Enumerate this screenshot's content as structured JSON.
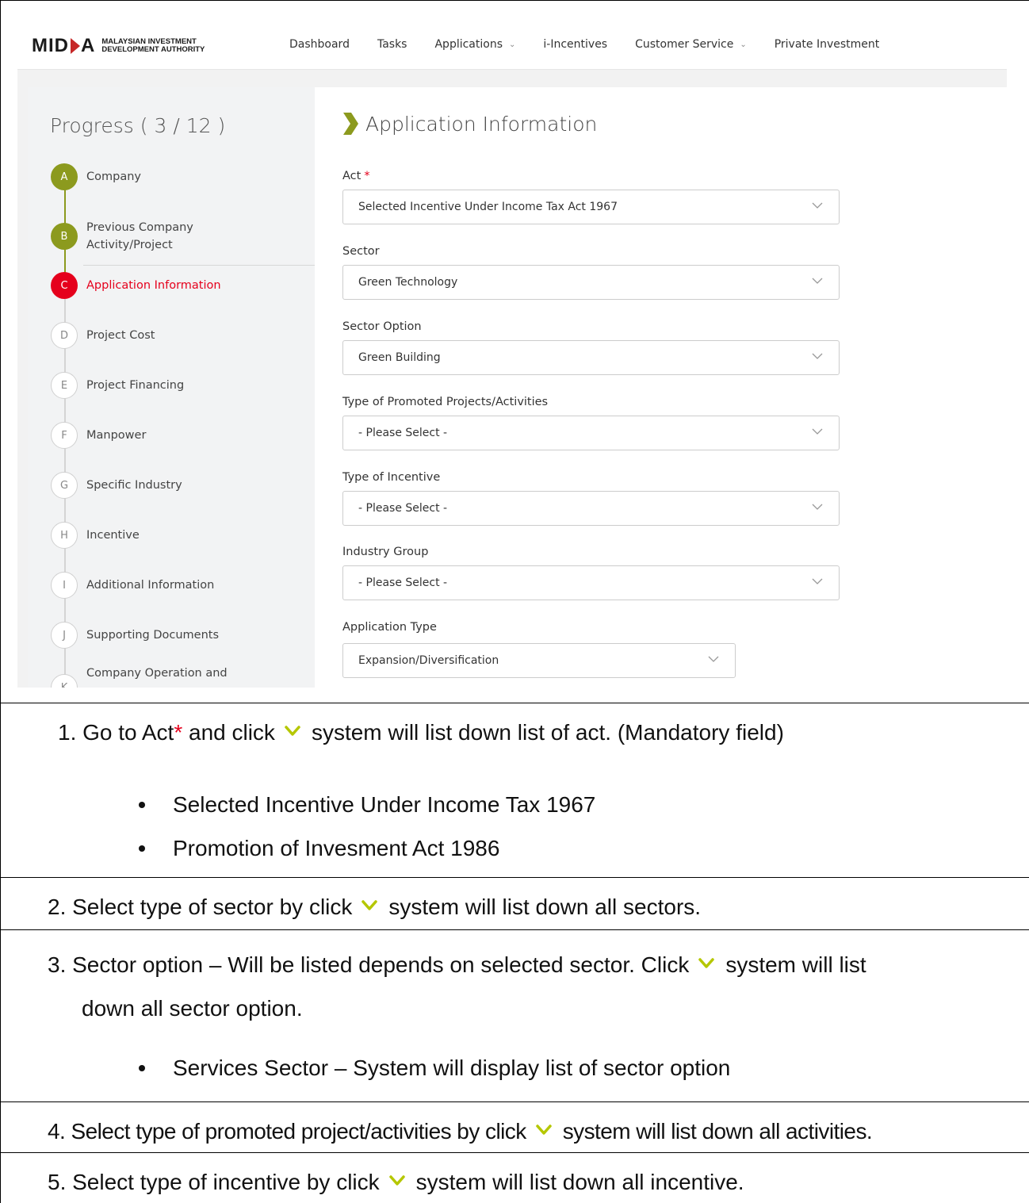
{
  "app": {
    "logo_mark": "MIDA",
    "logo_line1": "MALAYSIAN INVESTMENT",
    "logo_line2": "DEVELOPMENT AUTHORITY"
  },
  "nav": {
    "items": [
      {
        "label": "Dashboard",
        "dropdown": false
      },
      {
        "label": "Tasks",
        "dropdown": false
      },
      {
        "label": "Applications",
        "dropdown": true
      },
      {
        "label": "i-Incentives",
        "dropdown": false
      },
      {
        "label": "Customer Service",
        "dropdown": true
      },
      {
        "label": "Private Investment",
        "dropdown": false
      }
    ]
  },
  "progress": {
    "title": "Progress ( 3 / 12 )",
    "steps": [
      {
        "letter": "A",
        "label": "Company",
        "state": "done"
      },
      {
        "letter": "B",
        "label_line1": "Previous Company",
        "label_line2": "Activity/Project",
        "state": "done"
      },
      {
        "letter": "C",
        "label": "Application Information",
        "state": "active"
      },
      {
        "letter": "D",
        "label": "Project Cost",
        "state": "todo"
      },
      {
        "letter": "E",
        "label": "Project Financing",
        "state": "todo"
      },
      {
        "letter": "F",
        "label": "Manpower",
        "state": "todo"
      },
      {
        "letter": "G",
        "label": "Specific Industry",
        "state": "todo"
      },
      {
        "letter": "H",
        "label": "Incentive",
        "state": "todo"
      },
      {
        "letter": "I",
        "label": "Additional Information",
        "state": "todo"
      },
      {
        "letter": "J",
        "label": "Supporting Documents",
        "state": "todo"
      },
      {
        "letter": "K",
        "label": "Company Operation and",
        "state": "todo"
      }
    ]
  },
  "form": {
    "title": "Application Information",
    "fields": [
      {
        "label": "Act",
        "required": true,
        "value": "Selected Incentive Under Income Tax Act 1967"
      },
      {
        "label": "Sector",
        "required": false,
        "value": "Green Technology"
      },
      {
        "label": "Sector Option",
        "required": false,
        "value": "Green Building"
      },
      {
        "label": "Type of Promoted Projects/Activities",
        "required": false,
        "value": "- Please Select -"
      },
      {
        "label": "Type of Incentive",
        "required": false,
        "value": "- Please Select -"
      },
      {
        "label": "Industry Group",
        "required": false,
        "value": "- Please Select -"
      },
      {
        "label": "Application Type",
        "required": false,
        "value": "Expansion/Diversification"
      }
    ]
  },
  "instructions": {
    "step1_a": "1.  Go to Act",
    "step1_star": "*",
    "step1_b": " and click",
    "step1_c": "system will list down list of act. (Mandatory field)",
    "step1_bullets": [
      "Selected Incentive Under Income Tax 1967",
      "Promotion of Invesment Act 1986"
    ],
    "step2_a": "2.  Select type of sector by click",
    "step2_b": "system will list down all sectors.",
    "step3_a": "3.  Sector option – Will be listed depends on selected sector. Click",
    "step3_b": "system will list",
    "step3_c": "down all sector option.",
    "step3_bullets": [
      "Services Sector – System will display list of sector option"
    ],
    "step4_a": "4.  Select type of promoted project/activities by click",
    "step4_b": "system will list down all activities.",
    "step5_a": "5.  Select type of incentive by click",
    "step5_b": "system will list down all incentive."
  },
  "colors": {
    "accent_green": "#8c9a1e",
    "active_red": "#e5001c",
    "chevron_yellow_green": "#b5c700"
  }
}
